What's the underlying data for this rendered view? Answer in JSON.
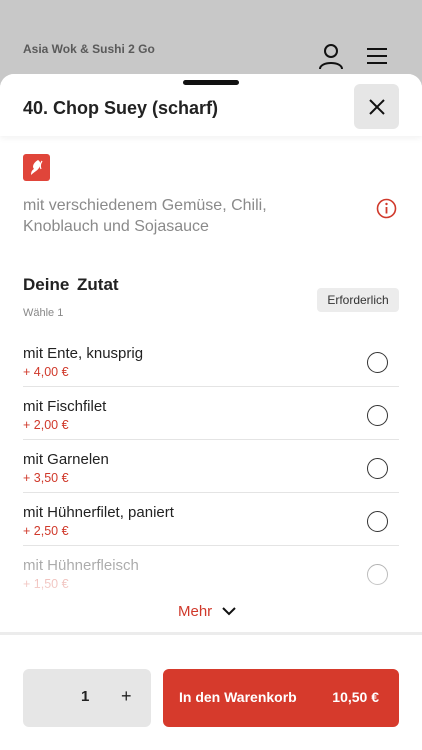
{
  "background": {
    "restaurant_name": "Asia Wok & Sushi 2 Go"
  },
  "dish": {
    "title": "40. Chop Suey (scharf)",
    "description": "mit verschiedenem Gemüse, Chili, Knoblauch und Sojasauce"
  },
  "option_group": {
    "title": "Deine  Zutat",
    "subtitle": "Wähle 1",
    "required_label": "Erforderlich",
    "options": [
      {
        "name": "mit Ente, knusprig",
        "price": "+ 4,00 €"
      },
      {
        "name": "mit Fischfilet",
        "price": "+ 2,00 €"
      },
      {
        "name": "mit Garnelen",
        "price": "+ 3,50 €"
      },
      {
        "name": "mit Hühnerfilet, paniert",
        "price": "+ 2,50 €"
      },
      {
        "name": "mit Hühnerfleisch",
        "price": "+ 1,50 €"
      }
    ],
    "more_label": "Mehr"
  },
  "footer": {
    "quantity": "1",
    "plus": "+",
    "cart_label": "In den Warenkorb",
    "cart_price": "10,50 €"
  },
  "colors": {
    "accent": "#d63a2c",
    "price": "#d0392b",
    "muted": "#8a8a8a"
  },
  "icons": [
    "user-icon",
    "menu-icon",
    "close-icon",
    "spicy-icon",
    "info-icon",
    "chevron-down-icon"
  ]
}
